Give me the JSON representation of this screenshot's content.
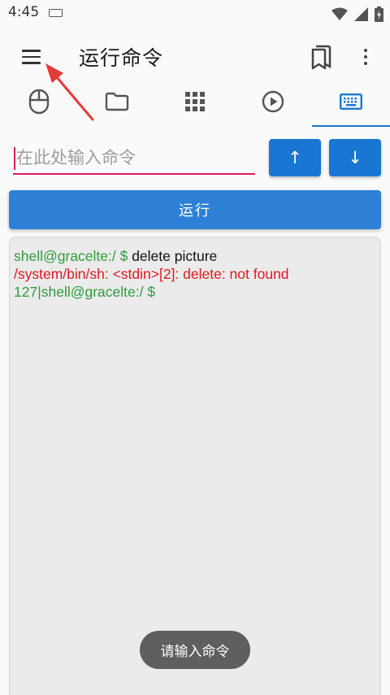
{
  "status_bar": {
    "time": "4:45",
    "icons": [
      "keyboard-icon",
      "wifi-icon",
      "signal-icon",
      "battery-charging-icon"
    ]
  },
  "app_bar": {
    "title": "运行命令",
    "icons": [
      "menu-icon",
      "bookmark-icon",
      "more-vert-icon"
    ]
  },
  "tabs": [
    {
      "icon": "mouse-icon",
      "active": false
    },
    {
      "icon": "folder-icon",
      "active": false
    },
    {
      "icon": "apps-grid-icon",
      "active": false
    },
    {
      "icon": "play-circle-icon",
      "active": false
    },
    {
      "icon": "keyboard-icon",
      "active": true
    }
  ],
  "command": {
    "placeholder": "在此处输入命令",
    "value": "",
    "history_up_label": "↑",
    "history_down_label": "↓",
    "run_label": "运行"
  },
  "output": {
    "lines": [
      {
        "prompt": "shell@gracelte:/ $ ",
        "command": "delete picture"
      },
      {
        "error": "/system/bin/sh: <stdin>[2]: delete: not found"
      },
      {
        "prompt": "127|shell@gracelte:/ $",
        "command": ""
      }
    ]
  },
  "toast": {
    "text": "请输入命令"
  },
  "colors": {
    "accent": "#1976d2",
    "input_underline": "#d81b60",
    "prompt_green": "#2e9e3a",
    "error_red": "#e0191f",
    "annotation_arrow": "#e53935"
  }
}
